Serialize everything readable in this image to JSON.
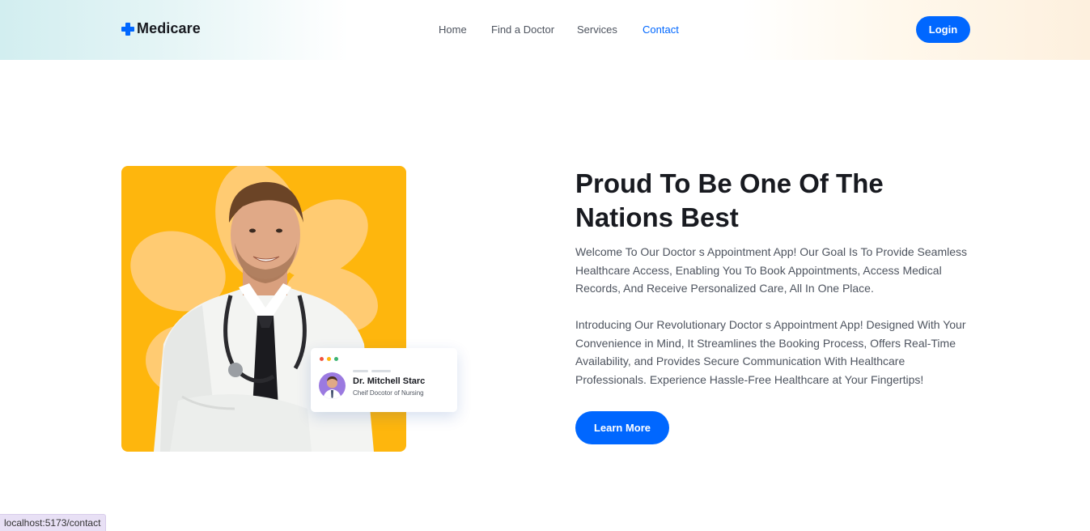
{
  "brand": {
    "name": "Medicare",
    "accent": "#0067ff"
  },
  "nav": {
    "items": [
      {
        "label": "Home",
        "active": false
      },
      {
        "label": "Find a Doctor",
        "active": false
      },
      {
        "label": "Services",
        "active": false
      },
      {
        "label": "Contact",
        "active": true
      }
    ],
    "login_label": "Login"
  },
  "hero": {
    "image_alt": "doctor-photo",
    "image_bg_color": "#feb60d",
    "card": {
      "name": "Dr. Mitchell Starc",
      "title": "Cheif Docotor of Nursing",
      "window_dot_colors": [
        "#f1543f",
        "#feb60d",
        "#3cb371"
      ]
    },
    "heading": "Proud To Be One Of The Nations Best",
    "paragraph_1": "Welcome To Our Doctor s Appointment App! Our Goal Is To Provide Seamless Healthcare Access, Enabling You To Book Appointments, Access Medical Records, And Receive Personalized Care, All In One Place.",
    "paragraph_2": "Introducing Our Revolutionary Doctor s Appointment App! Designed With Your Convenience in Mind, It Streamlines the Booking Process, Offers Real-Time Availability, and Provides Secure Communication With Healthcare Professionals. Experience Hassle-Free Healthcare at Your Fingertips!",
    "cta_label": "Learn More"
  },
  "status_bar": {
    "url": "localhost:5173/contact"
  }
}
